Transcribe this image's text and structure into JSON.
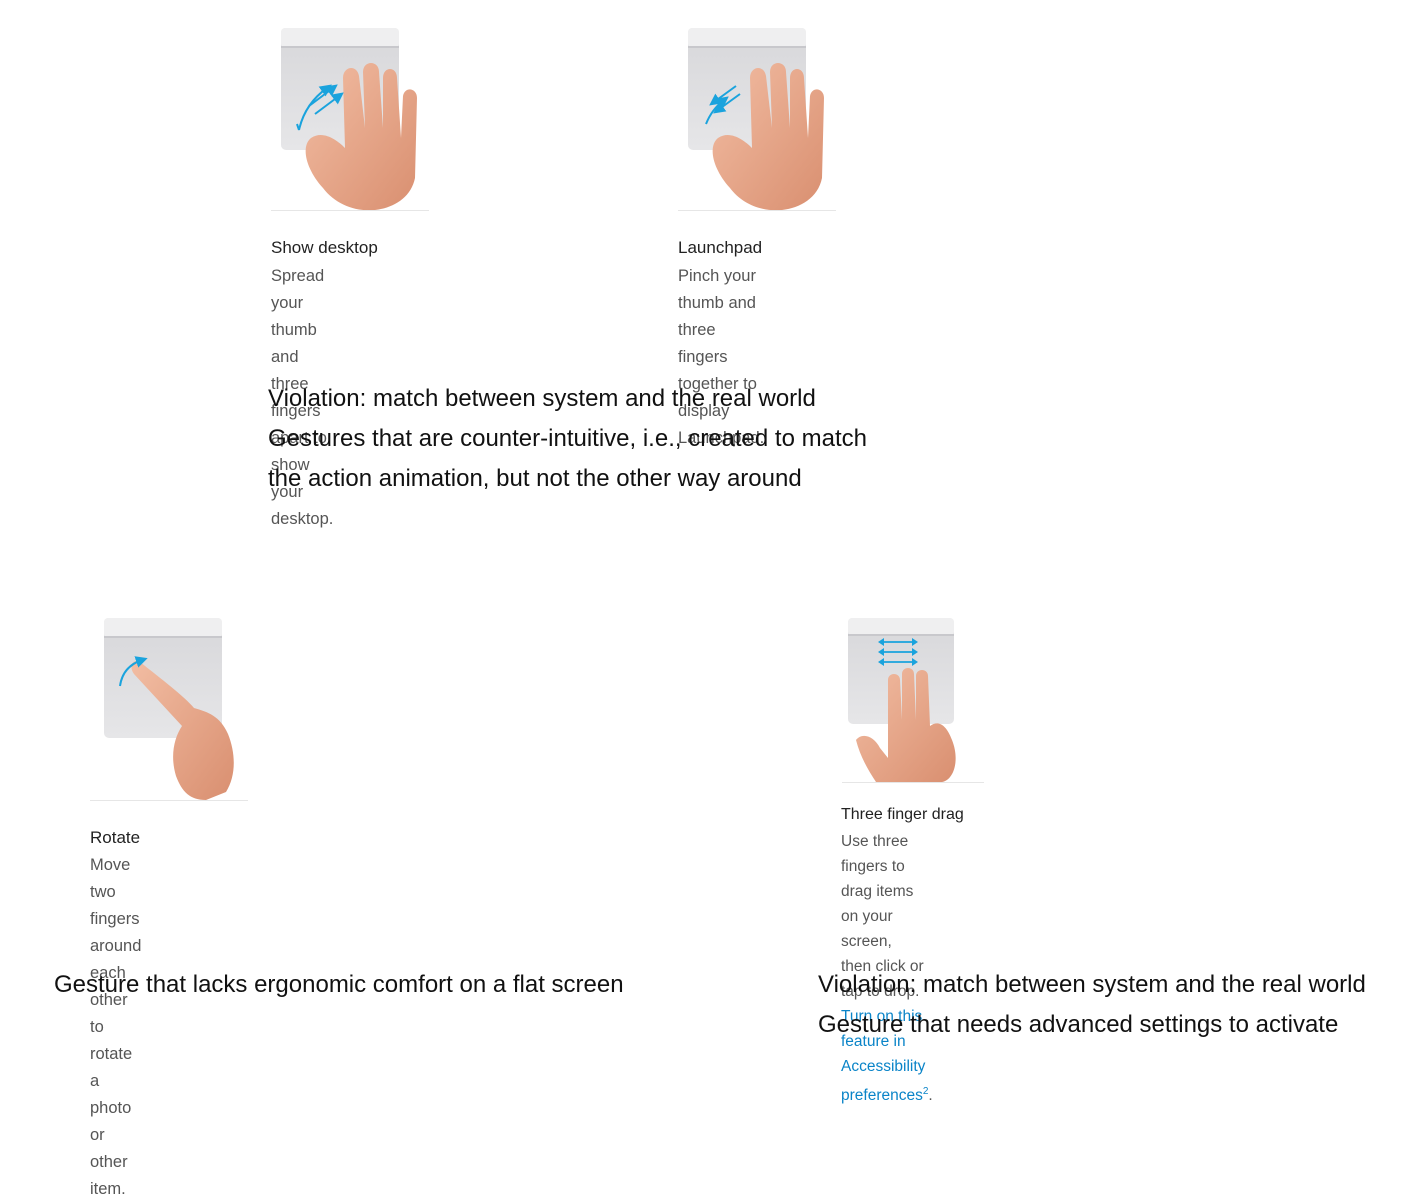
{
  "gestures": {
    "show_desktop": {
      "title": "Show desktop",
      "line1": "Spread your thumb and three fingers apart to",
      "line2": "show your desktop.",
      "icon": "hand-spread-icon"
    },
    "launchpad": {
      "title": "Launchpad",
      "line1": "Pinch your thumb and three fingers together to",
      "line2": "display Launchpad.",
      "icon": "hand-pinch-icon"
    },
    "rotate": {
      "title": "Rotate",
      "line1": "Move two fingers around each other to rotate a",
      "line2": "photo or other item.",
      "icon": "finger-rotate-icon"
    },
    "three_finger_drag": {
      "title": "Three finger drag",
      "line1": "Use three fingers to drag items on your screen,",
      "line2_text": "then click or tap to drop.",
      "line2_link": "Turn on this feature in",
      "line3_link": "Accessibility preferences",
      "footnote": "2",
      "line3_end": ".",
      "icon": "three-finger-drag-icon"
    }
  },
  "annotations": {
    "top": {
      "line1": "Violation: match between system and the real world",
      "line2": "Gestures that are counter-intuitive, i.e., created to match",
      "line3": "the action animation, but not the other way around"
    },
    "bottom_left": {
      "line1": "Gesture that lacks ergonomic comfort on a flat screen"
    },
    "bottom_right": {
      "line1": "Violation: match between system and the real world",
      "line2": "Gesture that needs advanced settings to activate"
    }
  },
  "colors": {
    "trackpad": "#d9d9dc",
    "trackpad_top": "#eeeeef",
    "skin": "#e9a98c",
    "arrow": "#1aa3dd",
    "link": "#0a84c8"
  }
}
